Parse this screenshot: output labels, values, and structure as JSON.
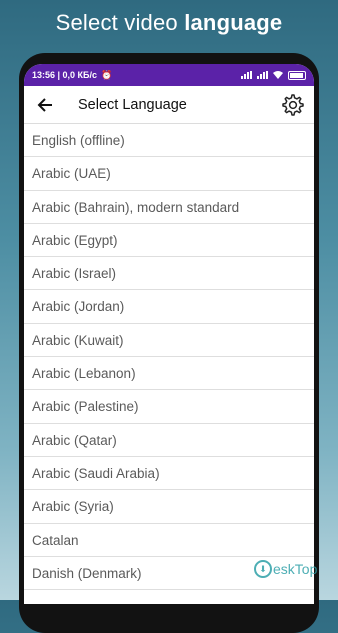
{
  "promo": {
    "headline_regular": "Select video ",
    "headline_bold": "language"
  },
  "statusbar": {
    "time": "13:56 | 0,0 КБ/с",
    "alarm_icon": "alarm-icon",
    "bg_color": "#5b22a8"
  },
  "appbar": {
    "title": "Select Language",
    "back_icon": "arrow-left-icon",
    "settings_icon": "gear-icon"
  },
  "languages": [
    "English (offline)",
    "Arabic (UAE)",
    "Arabic (Bahrain), modern standard",
    "Arabic (Egypt)",
    "Arabic (Israel)",
    "Arabic (Jordan)",
    "Arabic (Kuwait)",
    "Arabic (Lebanon)",
    "Arabic (Palestine)",
    "Arabic (Qatar)",
    "Arabic (Saudi Arabia)",
    "Arabic (Syria)",
    "Catalan",
    "Danish (Denmark)"
  ],
  "watermark": {
    "text": "eskTop"
  }
}
